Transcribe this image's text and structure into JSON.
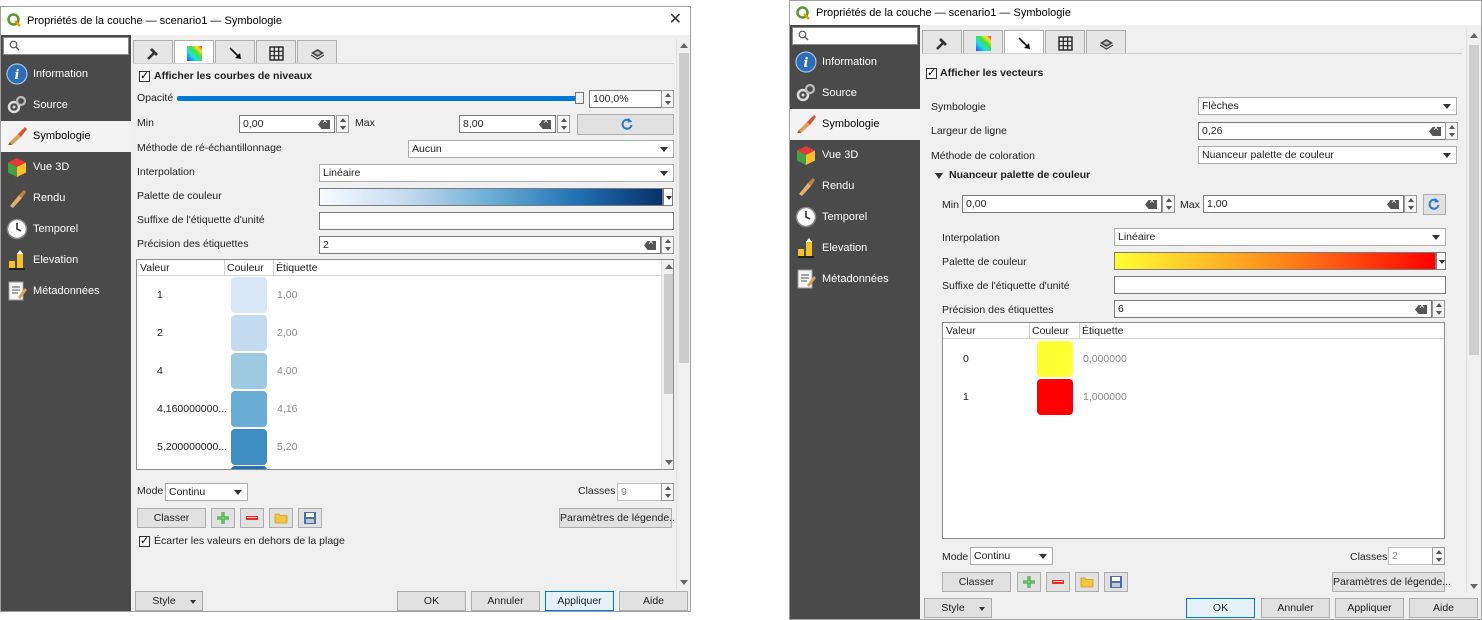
{
  "window1": {
    "title": "Propriétés de la couche — scenario1 — Symbologie",
    "sidebar": {
      "search_placeholder": "",
      "items": [
        {
          "label": "Information",
          "icon": "info-icon"
        },
        {
          "label": "Source",
          "icon": "source-icon"
        },
        {
          "label": "Symbologie",
          "icon": "brush-icon"
        },
        {
          "label": "Vue 3D",
          "icon": "cube-icon"
        },
        {
          "label": "Rendu",
          "icon": "rendu-icon"
        },
        {
          "label": "Temporel",
          "icon": "clock-icon"
        },
        {
          "label": "Elevation",
          "icon": "elevation-icon"
        },
        {
          "label": "Métadonnées",
          "icon": "metadata-icon"
        }
      ],
      "active_index": 2
    },
    "tabs": [
      "hammer-icon",
      "gradient-icon",
      "arrow-icon",
      "grid-icon",
      "mesh-icon"
    ],
    "active_tab": 1,
    "enable_label": "Afficher les courbes de niveaux",
    "opacity_label": "Opacité",
    "opacity_value": "100,0%",
    "opacity_fraction": 1.0,
    "min_label": "Min",
    "min_value": "0,00",
    "max_label": "Max",
    "max_value": "8,00",
    "resampling_label": "Méthode de ré-échantillonnage",
    "resampling_value": "Aucun",
    "interpolation_label": "Interpolation",
    "interpolation_value": "Linéaire",
    "ramp_label": "Palette de couleur",
    "ramp_colors": [
      "#f7fbff",
      "#c6dbef",
      "#6baed6",
      "#2171b5",
      "#08306b"
    ],
    "suffix_label": "Suffixe de l'étiquette d'unité",
    "suffix_value": "",
    "precision_label": "Précision des étiquettes",
    "precision_value": "2",
    "table_headers": [
      "Valeur",
      "Couleur",
      "Étiquette"
    ],
    "table_rows": [
      {
        "value": "1",
        "color": "#d9e7f5",
        "label": "1,00"
      },
      {
        "value": "2",
        "color": "#c4dbef",
        "label": "2,00"
      },
      {
        "value": "4",
        "color": "#9ecae1",
        "label": "4,00"
      },
      {
        "value": "4,160000000...",
        "color": "#6aaed6",
        "label": "4,16"
      },
      {
        "value": "5,200000000...",
        "color": "#3e8ec4",
        "label": "5,20"
      }
    ],
    "mode_label": "Mode",
    "mode_value": "Continu",
    "classes_label": "Classes",
    "classes_value": "9",
    "classify_label": "Classer",
    "legend_settings_label": "Paramètres de légende...",
    "clip_label": "Écarter les valeurs en dehors de la plage",
    "style_label": "Style",
    "ok_label": "OK",
    "cancel_label": "Annuler",
    "apply_label": "Appliquer",
    "help_label": "Aide"
  },
  "window2": {
    "title": "Propriétés de la couche — scenario1 — Symbologie",
    "sidebar": {
      "search_placeholder": "",
      "items": [
        {
          "label": "Information",
          "icon": "info-icon"
        },
        {
          "label": "Source",
          "icon": "source-icon"
        },
        {
          "label": "Symbologie",
          "icon": "brush-icon"
        },
        {
          "label": "Vue 3D",
          "icon": "cube-icon"
        },
        {
          "label": "Rendu",
          "icon": "rendu-icon"
        },
        {
          "label": "Temporel",
          "icon": "clock-icon"
        },
        {
          "label": "Elevation",
          "icon": "elevation-icon"
        },
        {
          "label": "Métadonnées",
          "icon": "metadata-icon"
        }
      ],
      "active_index": 2
    },
    "tabs": [
      "hammer-icon",
      "gradient-icon",
      "arrow-icon",
      "grid-icon",
      "mesh-icon"
    ],
    "active_tab": 2,
    "enable_label": "Afficher les vecteurs",
    "symbology_label": "Symbologie",
    "symbology_value": "Flèches",
    "line_width_label": "Largeur de ligne",
    "line_width_value": "0,26",
    "coloring_label": "Méthode de coloration",
    "coloring_value": "Nuanceur palette de couleur",
    "section_label": "Nuanceur palette de couleur",
    "min_label": "Min",
    "min_value": "0,00",
    "max_label": "Max",
    "max_value": "1,00",
    "interpolation_label": "Interpolation",
    "interpolation_value": "Linéaire",
    "ramp_label": "Palette de couleur",
    "ramp_colors": [
      "#ffff33",
      "#ff8c1a",
      "#ff0000"
    ],
    "suffix_label": "Suffixe de l'étiquette d'unité",
    "suffix_value": "",
    "precision_label": "Précision des étiquettes",
    "precision_value": "6",
    "table_headers": [
      "Valeur",
      "Couleur",
      "Étiquette"
    ],
    "table_rows": [
      {
        "value": "0",
        "color": "#ffff33",
        "label": "0,000000"
      },
      {
        "value": "1",
        "color": "#ff0000",
        "label": "1,000000"
      }
    ],
    "mode_label": "Mode",
    "mode_value": "Continu",
    "classes_label": "Classes",
    "classes_value": "2",
    "classify_label": "Classer",
    "legend_settings_label": "Paramètres de légende...",
    "style_label": "Style",
    "ok_label": "OK",
    "cancel_label": "Annuler",
    "apply_label": "Appliquer",
    "help_label": "Aide"
  }
}
